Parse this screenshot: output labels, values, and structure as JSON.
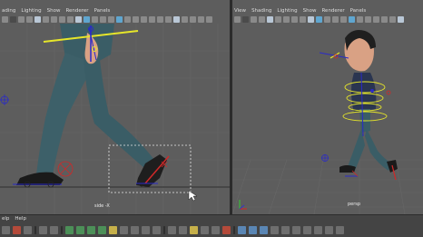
{
  "left_panel": {
    "menu": [
      "ading",
      "Lighting",
      "Show",
      "Renderer",
      "Panels"
    ],
    "camera_label": "side -X"
  },
  "right_panel": {
    "menu": [
      "View",
      "Shading",
      "Lighting",
      "Show",
      "Renderer",
      "Panels"
    ],
    "camera_label": "persp"
  },
  "bottom_bar": {
    "menu": [
      "elp",
      "Help"
    ]
  },
  "colors": {
    "viewport_bg": "#5d5d5d",
    "grid": "#6a6a6a",
    "skin_dark_teal": "#3a5d66",
    "selection_yellow": "#e6e62a",
    "ik_blue": "#2a2ac8",
    "manip_red": "#d02828"
  },
  "icons": {
    "toolbar": [
      "select-camera-icon",
      "grid-icon",
      "wireframe-icon",
      "smooth-shade-icon",
      "texture-icon",
      "light-icon",
      "isolate-icon",
      "xray-icon"
    ],
    "shelf": [
      "keyframe-icon",
      "ik-handle-icon",
      "joint-icon",
      "render-icon",
      "snap-icon",
      "layout-icon"
    ]
  }
}
